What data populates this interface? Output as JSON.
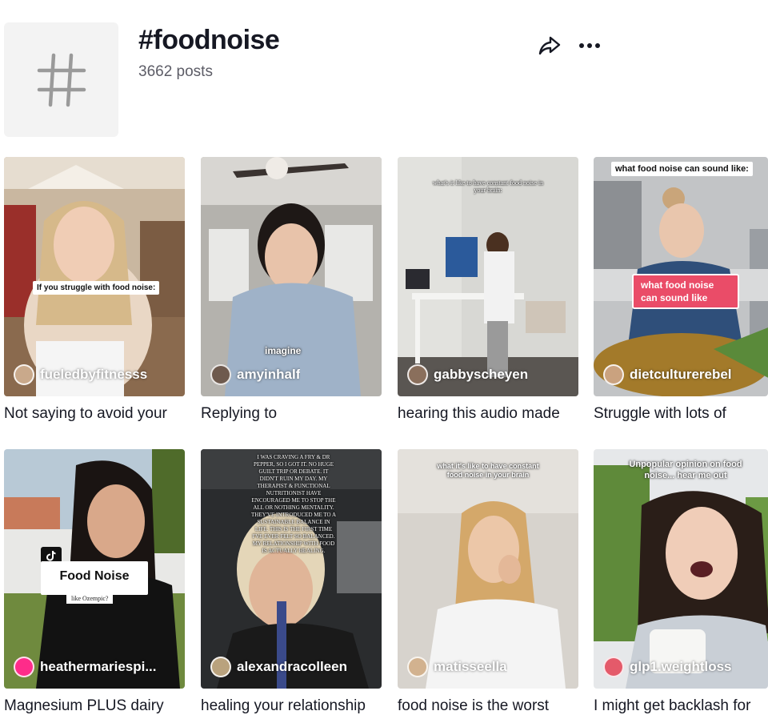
{
  "hashtag": {
    "title": "#foodnoise",
    "post_count": "3662 posts",
    "icon": "hashtag-icon"
  },
  "header_actions": {
    "share_icon": "share-arrow-icon",
    "more_icon": "more-options-icon"
  },
  "videos": [
    {
      "author": "fueledbyfitnesss",
      "description": "Not saying to avoid your",
      "overlay_text": "If you struggle with food noise:",
      "avatar_color": "#c9a98b"
    },
    {
      "author": "amyinhalf",
      "description": "Replying to",
      "overlay_text": "imagine",
      "avatar_color": "#6e5a4e"
    },
    {
      "author": "gabbyscheyen",
      "description": "hearing this audio made",
      "overlay_text": "what's it like to have constant food noise in your brain:",
      "avatar_color": "#8a6f5c"
    },
    {
      "author": "dietculturerebel",
      "description": "Struggle with lots of",
      "overlay_text_top": "what food noise can sound like:",
      "overlay_text_badge": "what food noise can sound like",
      "avatar_color": "#caa27f"
    },
    {
      "author": "heathermariespi...",
      "description": "Magnesium PLUS dairy",
      "overlay_title": "Food Noise",
      "overlay_subtitle": "like Ozempic?",
      "avatar_color": "#fe2c8a"
    },
    {
      "author": "alexandracolleen",
      "description": "healing your relationship",
      "overlay_text": "I WAS CRAVING A FRY & DR PEPPER, SO I GOT IT. NO HUGE GUILT TRIP OR DEBATE. IT DIDN'T RUIN MY DAY. MY THERAPIST & FUNCTIONAL NUTRITIONIST HAVE ENCOURAGED ME TO STOP THE ALL OR NOTHING MENTALITY. THEY'VE INTRODUCED ME TO A SUSTAINABLE BALANCE IN LIFE. THIS IS THE FIRST TIME I'VE EVER FELT SO BALANCED. MY RELATIONSHIP WITH FOOD IS ACTUALLY HEALING.",
      "avatar_color": "#b9a27d"
    },
    {
      "author": "matisseella",
      "description": "food noise is the worst",
      "overlay_text": "what it's like to have constant food noise in your brain",
      "avatar_color": "#d2b28f"
    },
    {
      "author": "glp1.weightloss",
      "description": "I might get backlash for",
      "overlay_text": "Unpopular opinion on food noise... hear me out",
      "avatar_color": "#e45a6a"
    }
  ]
}
